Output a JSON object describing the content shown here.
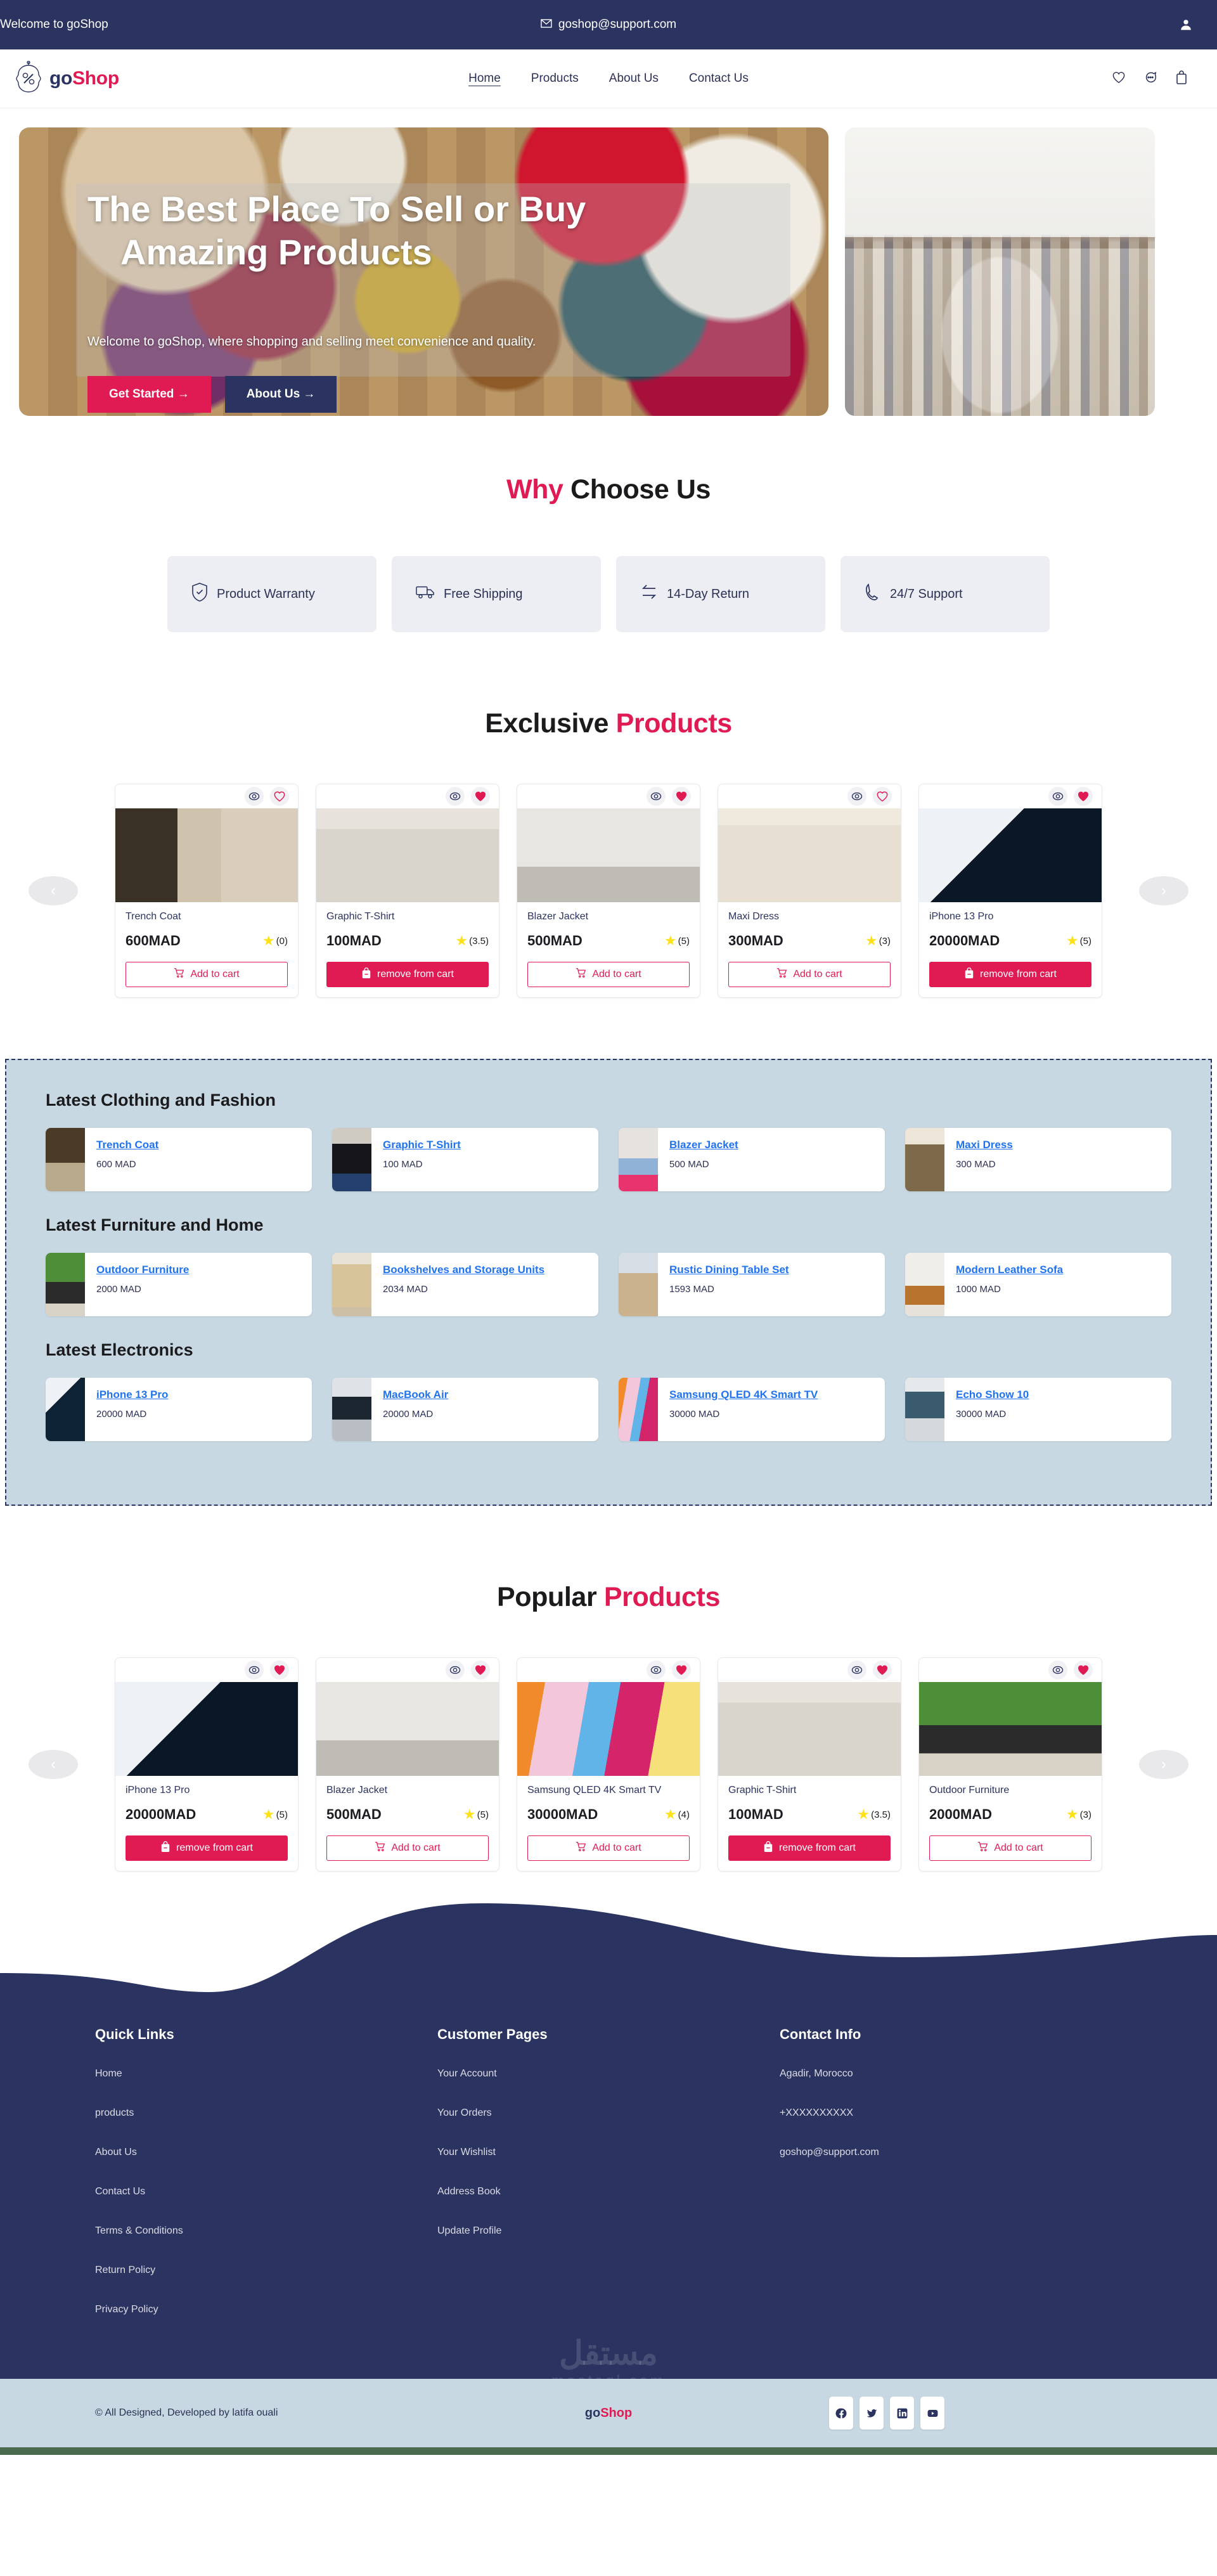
{
  "topbar": {
    "welcome": "Welcome to goShop",
    "email": "goshop@support.com",
    "mail_icon": "envelope-icon",
    "user_icon": "user-icon"
  },
  "nav": {
    "brand_go": "go",
    "brand_shop": "Shop",
    "links": [
      {
        "label": "Home",
        "active": true
      },
      {
        "label": "Products",
        "active": false
      },
      {
        "label": "About Us",
        "active": false
      },
      {
        "label": "Contact Us",
        "active": false
      }
    ],
    "icons": [
      "heart-icon",
      "chat-icon",
      "bag-icon"
    ]
  },
  "hero": {
    "title_line1": "The Best Place To Sell or Buy",
    "title_line2": "Amazing Products",
    "subtitle": "Welcome to goShop, where shopping and selling meet convenience and quality.",
    "btn_primary": "Get Started →",
    "btn_secondary": "About Us →"
  },
  "why": {
    "title_accent": "Why",
    "title_rest": " Choose Us",
    "cards": [
      {
        "icon": "shield-check-icon",
        "label": "Product Warranty"
      },
      {
        "icon": "truck-icon",
        "label": "Free Shipping"
      },
      {
        "icon": "exchange-arrows-icon",
        "label": "14-Day Return"
      },
      {
        "icon": "phone-icon",
        "label": "24/7 Support"
      }
    ]
  },
  "exclusive": {
    "title_rest": "Exclusive ",
    "title_accent": "Products",
    "prev_label": "‹",
    "next_label": "›",
    "products": [
      {
        "name": "Trench Coat",
        "price": "600MAD",
        "rating": "(0)",
        "in_cart": false,
        "cta": "Add to cart",
        "wish": false,
        "img": "img-trench"
      },
      {
        "name": "Graphic T-Shirt",
        "price": "100MAD",
        "rating": "(3.5)",
        "in_cart": true,
        "cta": "remove from cart",
        "wish": true,
        "img": "img-tshirt"
      },
      {
        "name": "Blazer Jacket",
        "price": "500MAD",
        "rating": "(5)",
        "in_cart": false,
        "cta": "Add to cart",
        "wish": true,
        "img": "img-blazer"
      },
      {
        "name": "Maxi Dress",
        "price": "300MAD",
        "rating": "(3)",
        "in_cart": false,
        "cta": "Add to cart",
        "wish": false,
        "img": "img-maxi"
      },
      {
        "name": "iPhone 13 Pro",
        "price": "20000MAD",
        "rating": "(5)",
        "in_cart": true,
        "cta": "remove from cart",
        "wish": true,
        "img": "img-iphone"
      }
    ]
  },
  "latest": {
    "groups": [
      {
        "heading": "Latest Clothing and Fashion",
        "items": [
          {
            "name": "Trench Coat",
            "price": "600 MAD",
            "thumb": "th-trench"
          },
          {
            "name": "Graphic T-Shirt",
            "price": "100 MAD",
            "thumb": "th-tshirt"
          },
          {
            "name": "Blazer Jacket",
            "price": "500 MAD",
            "thumb": "th-blazer"
          },
          {
            "name": "Maxi Dress",
            "price": "300 MAD",
            "thumb": "th-maxi"
          }
        ]
      },
      {
        "heading": "Latest Furniture and Home",
        "items": [
          {
            "name": "Outdoor Furniture",
            "price": "2000 MAD",
            "thumb": "th-outdoor"
          },
          {
            "name": "Bookshelves and Storage Units",
            "price": "2034 MAD",
            "thumb": "th-book"
          },
          {
            "name": "Rustic Dining Table Set",
            "price": "1593 MAD",
            "thumb": "th-dining"
          },
          {
            "name": "Modern Leather Sofa",
            "price": "1000 MAD",
            "thumb": "th-sofa"
          }
        ]
      },
      {
        "heading": "Latest Electronics",
        "items": [
          {
            "name": "iPhone 13 Pro",
            "price": "20000 MAD",
            "thumb": "th-iphone"
          },
          {
            "name": "MacBook Air",
            "price": "20000 MAD",
            "thumb": "th-macbook"
          },
          {
            "name": "Samsung QLED 4K Smart TV",
            "price": "30000 MAD",
            "thumb": "th-tv"
          },
          {
            "name": "Echo Show 10",
            "price": "30000 MAD",
            "thumb": "th-echo"
          }
        ]
      }
    ]
  },
  "popular": {
    "title_rest": "Popular ",
    "title_accent": "Products",
    "prev_label": "‹",
    "next_label": "›",
    "products": [
      {
        "name": "iPhone 13 Pro",
        "price": "20000MAD",
        "rating": "(5)",
        "in_cart": true,
        "cta": "remove from cart",
        "wish": true,
        "img": "img-iphone"
      },
      {
        "name": "Blazer Jacket",
        "price": "500MAD",
        "rating": "(5)",
        "in_cart": false,
        "cta": "Add to cart",
        "wish": true,
        "img": "img-blazer"
      },
      {
        "name": "Samsung QLED 4K Smart TV",
        "price": "30000MAD",
        "rating": "(4)",
        "in_cart": false,
        "cta": "Add to cart",
        "wish": true,
        "img": "img-tv"
      },
      {
        "name": "Graphic T-Shirt",
        "price": "100MAD",
        "rating": "(3.5)",
        "in_cart": true,
        "cta": "remove from cart",
        "wish": true,
        "img": "img-tshirt"
      },
      {
        "name": "Outdoor Furniture",
        "price": "2000MAD",
        "rating": "(3)",
        "in_cart": false,
        "cta": "Add to cart",
        "wish": true,
        "img": "img-outdoor"
      }
    ]
  },
  "footer": {
    "columns": [
      {
        "heading": "Quick Links",
        "links": [
          "Home",
          "products",
          "About Us",
          "Contact Us",
          "Terms & Conditions",
          "Return Policy",
          "Privacy Policy"
        ]
      },
      {
        "heading": "Customer Pages",
        "links": [
          "Your Account",
          "Your Orders",
          "Your Wishlist",
          "Address Book",
          "Update Profile"
        ]
      }
    ],
    "contact": {
      "heading": "Contact Info",
      "address": "Agadir, Morocco",
      "phone": "+XXXXXXXXXX",
      "email": "goshop@support.com"
    },
    "watermark_main": "مستقل",
    "watermark_sub": "mostaql.com",
    "copyright": "© All Designed, Developed by latifa ouali",
    "brand_go": "go",
    "brand_shop": "Shop",
    "socials": [
      "facebook-icon",
      "twitter-icon",
      "linkedin-icon",
      "youtube-icon"
    ]
  },
  "colors": {
    "navy": "#2b3360",
    "accent": "#e01b53",
    "light_blue": "#c7d8e2",
    "link_blue": "#2073ef",
    "star_yellow": "#ffe11b"
  }
}
